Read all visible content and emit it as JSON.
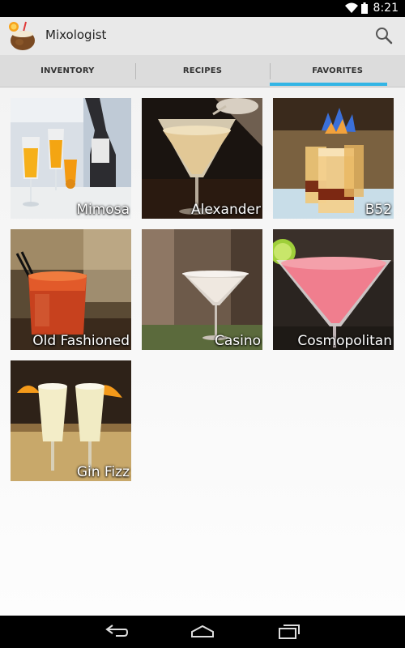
{
  "status_bar": {
    "time": "8:21"
  },
  "action_bar": {
    "title": "Mixologist",
    "app_icon": "coconut-drink-icon",
    "search_icon": "search-icon"
  },
  "tabs": [
    {
      "label": "INVENTORY",
      "active": false
    },
    {
      "label": "RECIPES",
      "active": false
    },
    {
      "label": "FAVORITES",
      "active": true
    }
  ],
  "accent_color": "#33b5e5",
  "favorites": [
    {
      "name": "Mimosa"
    },
    {
      "name": "Alexander"
    },
    {
      "name": "B52"
    },
    {
      "name": "Old Fashioned"
    },
    {
      "name": "Casino"
    },
    {
      "name": "Cosmopolitan"
    },
    {
      "name": "Gin Fizz"
    }
  ],
  "nav_bar": {
    "back_icon": "back-icon",
    "home_icon": "home-icon",
    "recents_icon": "recent-apps-icon"
  }
}
